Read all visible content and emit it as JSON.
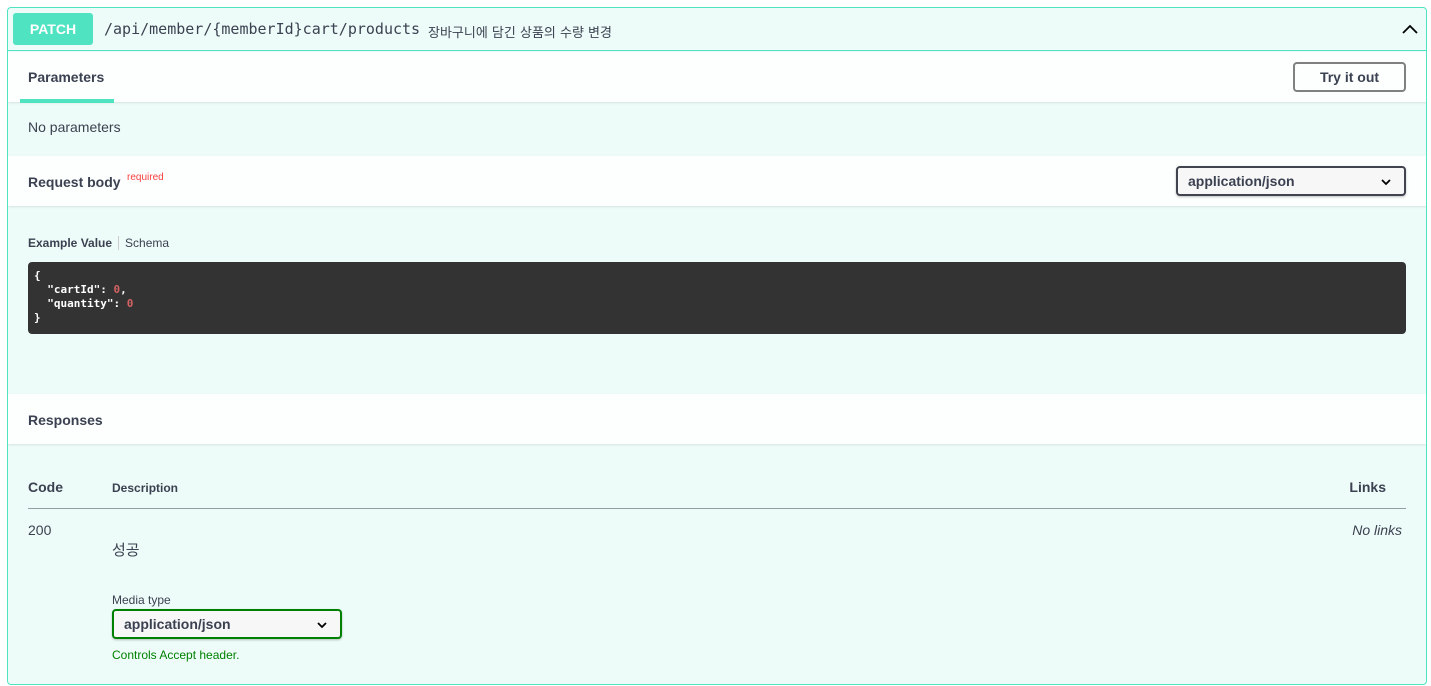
{
  "operation": {
    "method": "PATCH",
    "path": "/api/member/{memberId}cart/products",
    "summary": "장바구니에 담긴 상품의 수량 변경"
  },
  "parameters": {
    "tab_label": "Parameters",
    "try_label": "Try it out",
    "empty_text": "No parameters"
  },
  "request_body": {
    "title": "Request body",
    "required_label": "required",
    "content_type": "application/json",
    "example_tab": "Example Value",
    "schema_tab": "Schema",
    "example": {
      "open": "{",
      "lines": [
        {
          "key": "\"cartId\"",
          "value": "0",
          "trail": ","
        },
        {
          "key": "\"quantity\"",
          "value": "0",
          "trail": ""
        }
      ],
      "close": "}"
    }
  },
  "responses": {
    "title": "Responses",
    "headers": {
      "code": "Code",
      "description": "Description",
      "links": "Links"
    },
    "rows": [
      {
        "code": "200",
        "description": "성공",
        "links": "No links",
        "media_type_label": "Media type",
        "media_type": "application/json",
        "controls_note": "Controls Accept header."
      }
    ]
  },
  "colors": {
    "patch_accent": "#50e3c2",
    "required": "#f93e3e",
    "code_bg": "#333333",
    "number": "#d36363",
    "note_green": "#008000"
  },
  "icons": {
    "collapse": "chevron-up-icon",
    "select": "chevron-down-icon"
  }
}
